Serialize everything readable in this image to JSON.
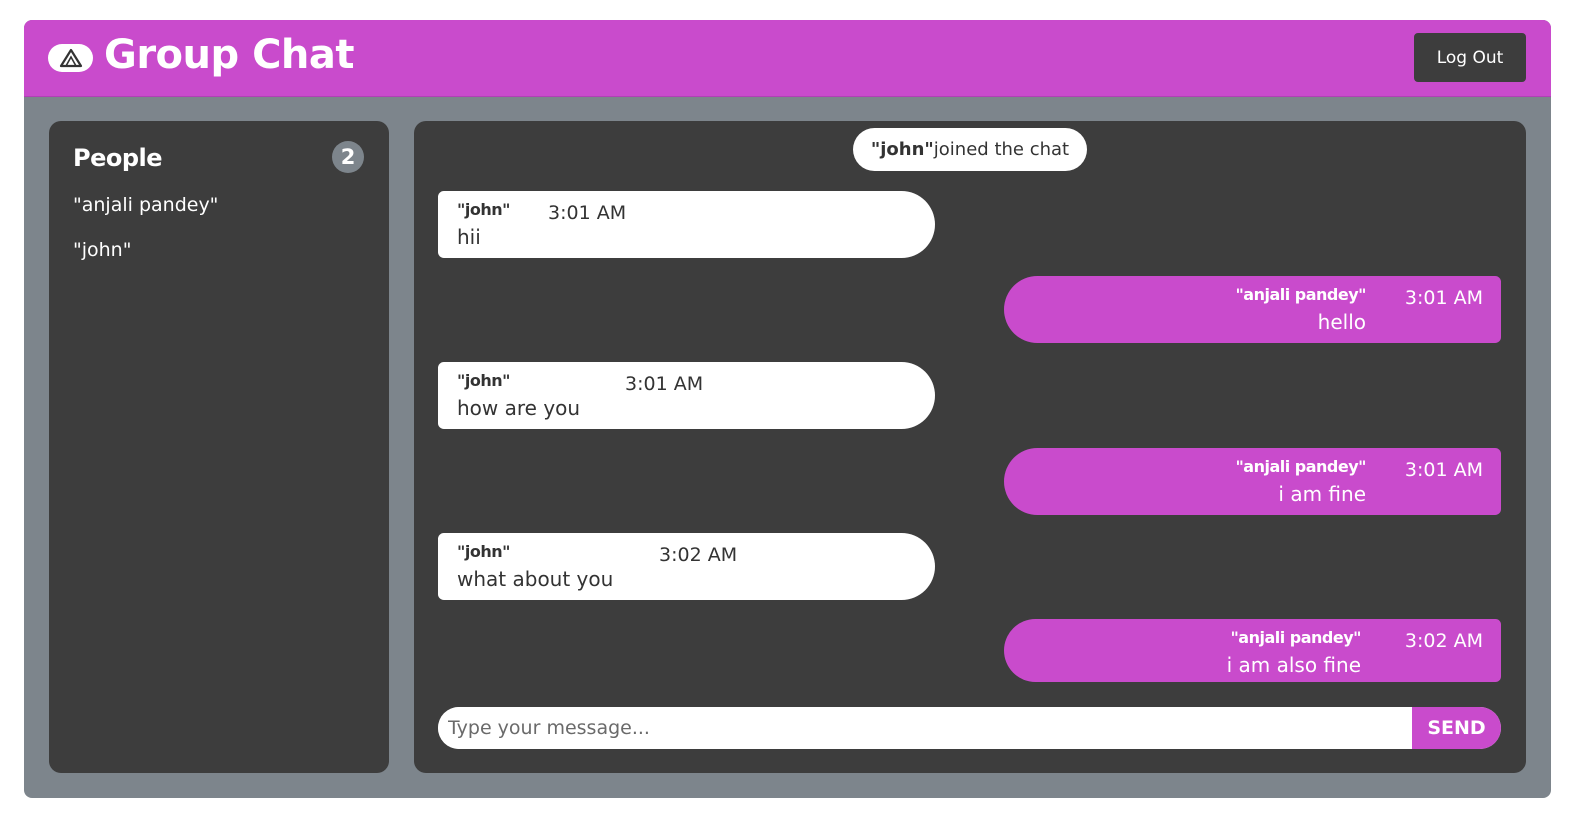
{
  "header": {
    "title": "Group Chat",
    "logo_icon": "a-logo-icon",
    "logout_label": "Log Out"
  },
  "sidebar": {
    "title": "People",
    "count": "2",
    "people": [
      "\"anjali pandey\"",
      "\"john\""
    ]
  },
  "chat": {
    "system": {
      "name": "\"john\"",
      "text": "joined the chat"
    },
    "messages": [
      {
        "sender": "\"john\"",
        "time": "3:01 AM",
        "text": "hii",
        "direction": "incoming"
      },
      {
        "sender": "\"anjali pandey\"",
        "time": "3:01 AM",
        "text": "hello",
        "direction": "outgoing"
      },
      {
        "sender": "\"john\"",
        "time": "3:01 AM",
        "text": "how are you",
        "direction": "incoming"
      },
      {
        "sender": "\"anjali pandey\"",
        "time": "3:01 AM",
        "text": "i am fine",
        "direction": "outgoing"
      },
      {
        "sender": "\"john\"",
        "time": "3:02 AM",
        "text": "what about you",
        "direction": "incoming"
      },
      {
        "sender": "\"anjali pandey\"",
        "time": "3:02 AM",
        "text": "i am also fine",
        "direction": "outgoing"
      }
    ]
  },
  "composer": {
    "placeholder": "Type your message...",
    "send_label": "SEND"
  },
  "colors": {
    "accent": "#c94bcc",
    "panel": "#3d3d3d",
    "frame": "#7d858c"
  }
}
